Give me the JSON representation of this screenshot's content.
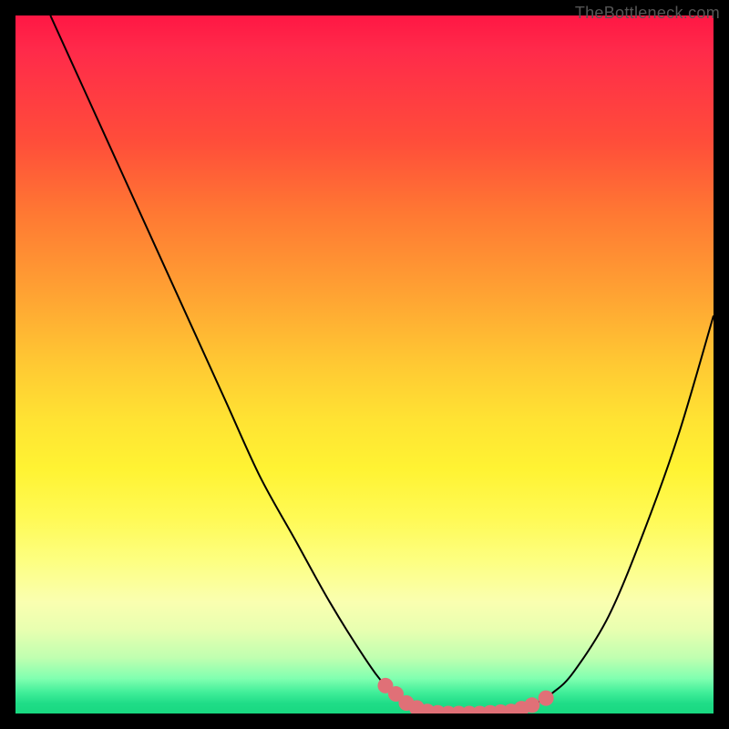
{
  "watermark": "TheBottleneck.com",
  "colors": {
    "background_frame": "#000000",
    "curve": "#000000",
    "marker": "#e07077",
    "gradient_top": "#ff1744",
    "gradient_bottom": "#18d880"
  },
  "chart_data": {
    "type": "line",
    "title": "",
    "xlabel": "",
    "ylabel": "",
    "xlim": [
      0,
      100
    ],
    "ylim": [
      0,
      100
    ],
    "grid": false,
    "legend": false,
    "series": [
      {
        "name": "bottleneck-curve",
        "x": [
          5,
          10,
          15,
          20,
          25,
          30,
          35,
          40,
          45,
          50,
          53,
          56,
          59,
          62,
          65,
          68,
          71,
          74,
          77,
          80,
          85,
          90,
          95,
          100
        ],
        "y": [
          100,
          89,
          78,
          67,
          56,
          45,
          34,
          25,
          16,
          8,
          4,
          1.5,
          0.3,
          0,
          0,
          0,
          0.3,
          1.2,
          3,
          6,
          14,
          26,
          40,
          57
        ]
      }
    ],
    "markers": {
      "name": "highlighted-range",
      "x": [
        53,
        54.5,
        56,
        57.5,
        59,
        60.5,
        62,
        63.5,
        65,
        66.5,
        68,
        69.5,
        71,
        72.5,
        74,
        76
      ],
      "y": [
        4,
        2.8,
        1.5,
        0.8,
        0.3,
        0.1,
        0,
        0,
        0,
        0,
        0.1,
        0.2,
        0.3,
        0.7,
        1.2,
        2.2
      ]
    }
  }
}
